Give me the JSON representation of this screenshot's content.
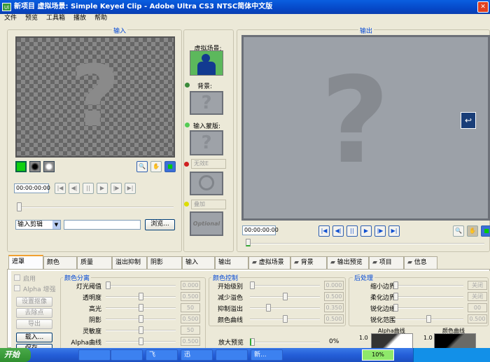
{
  "window": {
    "title": "新项目   虚拟场景: Simple Keyed Clip   - Adobe Ultra CS3 NTSC简体中文版",
    "app_icon": "Ul"
  },
  "menu": [
    "文件",
    "预览",
    "工具箱",
    "播放",
    "帮助"
  ],
  "input_panel": {
    "title": "输入",
    "timecode": "00:00:00:00",
    "source_select": "输入剪辑",
    "path_value": "",
    "browse_label": "浏览..."
  },
  "middle": {
    "virtual_set_label": "虚拟场景:",
    "background_label": "背景:",
    "input_mask_label": "输入蒙版:",
    "garbage_select": "无效E",
    "overlay_select": "叠加",
    "optional_text": "Optional"
  },
  "output_panel": {
    "title": "输出",
    "timecode": "00:00:00:00"
  },
  "tabs": [
    "遮罩",
    "颜色",
    "质量",
    "溢出抑制",
    "阴影",
    "输入",
    "输出",
    "虚拟场景",
    "背景",
    "输出预览",
    "项目",
    "信息"
  ],
  "matte": {
    "enable_label": "启用",
    "alpha_boost_label": "Alpha 增强",
    "buttons": [
      "设置抠像",
      "去除点",
      "导出",
      "载入...",
      "保存..."
    ],
    "color_sep": {
      "title": "颜色分离",
      "rows": [
        {
          "label": "灯光阈值",
          "value": "0.000",
          "pos": 0
        },
        {
          "label": "透明度",
          "value": "0.500",
          "pos": 0.5
        },
        {
          "label": "高光",
          "value": "50",
          "pos": 0.5
        },
        {
          "label": "阴影",
          "value": "0.500",
          "pos": 0.5
        },
        {
          "label": "灵敏度",
          "value": "50",
          "pos": 0.5
        },
        {
          "label": "Alpha曲线",
          "value": "0.500",
          "pos": 0.5
        }
      ]
    },
    "color_ctrl": {
      "title": "颜色控制",
      "rows": [
        {
          "label": "开始级别",
          "value": "0.000",
          "pos": 0
        },
        {
          "label": "减少溢色",
          "value": "0.500",
          "pos": 0.5
        },
        {
          "label": "抑制溢出",
          "value": "0.350",
          "pos": 0.25
        },
        {
          "label": "颜色曲线",
          "value": "0.500",
          "pos": 0.5
        }
      ]
    },
    "zoom": {
      "label": "放大预览",
      "value": "0%"
    },
    "post": {
      "title": "后处理",
      "rows": [
        {
          "label": "缩小边界",
          "value": "关闭",
          "pos": 0
        },
        {
          "label": "柔化边界",
          "value": "关闭",
          "pos": 0
        },
        {
          "label": "锐化边缘",
          "value": "00",
          "pos": 0
        },
        {
          "label": "锐化范围",
          "value": "0.500",
          "pos": 0.5
        }
      ]
    },
    "alpha_curve_label": "Alpha曲线",
    "color_curve_label": "颜色曲线",
    "curve_max_a": "1.0",
    "curve_max_b": "1.0"
  },
  "taskbar": {
    "start": "开始",
    "tasks": [
      "",
      "",
      "",
      "",
      "",
      "飞",
      "迅",
      "",
      "新..."
    ],
    "battery": "10%"
  }
}
